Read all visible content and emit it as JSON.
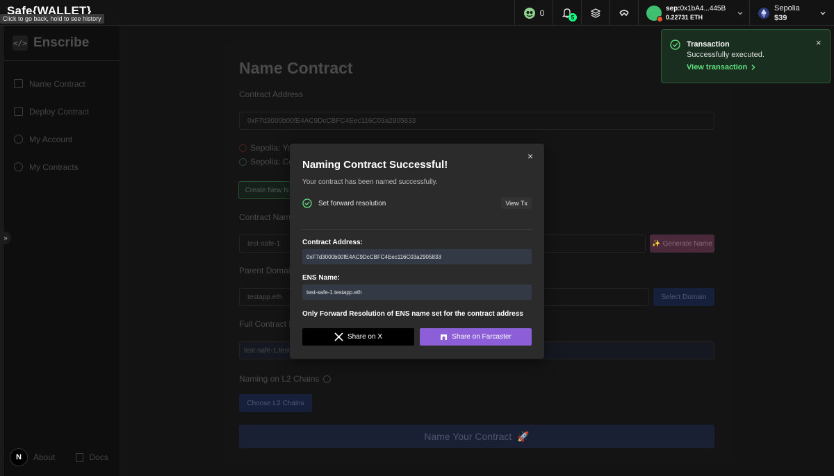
{
  "safe_bar": {
    "brand": "Safe{WALLET}",
    "tooltip": "Click to go back, hold to see history",
    "points": "0",
    "notifications_count": "5",
    "account": {
      "prefix": "sep:",
      "address": "0x1bA4...445B",
      "balance": "0.22731 ETH"
    },
    "network": {
      "name": "Sepolia",
      "value": "$39"
    }
  },
  "sidebar": {
    "logo": "Enscribe",
    "logo_glyph": "</>",
    "items": [
      {
        "label": "Name Contract",
        "icon": "file-icon"
      },
      {
        "label": "Deploy Contract",
        "icon": "edit-icon"
      },
      {
        "label": "My Account",
        "icon": "user-icon"
      },
      {
        "label": "My Contracts",
        "icon": "clock-icon"
      }
    ],
    "footer": {
      "badge": "N",
      "about": "About",
      "docs": "Docs"
    },
    "expand_glyph": "»"
  },
  "form": {
    "title": "Name Contract",
    "contract_address_label": "Contract Address",
    "contract_address_value": "0xF7d3000b00fE4AC9DcCBFC4Eec116C03a2905833",
    "status_1": "Sepolia: Yo",
    "status_2": "Sepolia: Co",
    "create_new_label": "Create New N",
    "contract_name_label": "Contract Name",
    "contract_name_value": "test-safe-1",
    "generate_name_label": "Generate Name",
    "parent_domain_label": "Parent Domain",
    "parent_domain_value": "testapp.eth",
    "select_domain_label": "Select Domain",
    "full_name_label": "Full Contract N",
    "full_name_value": "test-safe-1.testa",
    "l2_label": "Naming on L2 Chains",
    "choose_l2_label": "Choose L2 Chains",
    "submit_label": "Name Your Contract"
  },
  "toast": {
    "title": "Transaction",
    "message": "Successfully executed.",
    "link": "View transaction",
    "close": "×"
  },
  "modal": {
    "title": "Naming Contract Successful!",
    "subtitle": "Your contract has been named successfully.",
    "step_label": "Set forward resolution",
    "view_tx": "View Tx",
    "contract_address_label": "Contract Address:",
    "contract_address_value": "0xF7d3000b00fE4AC9DcCBFC4Eec116C03a2905833",
    "ens_name_label": "ENS Name:",
    "ens_name_value": "test-safe-1.testapp.eth",
    "note": "Only Forward Resolution of ENS name set for the contract address",
    "share_x": "Share on X",
    "share_farcaster": "Share on Farcaster",
    "close": "×"
  },
  "colors": {
    "success_green": "#5fe07f",
    "farcaster_purple": "#8c5fd8",
    "safe_green": "#12ff80"
  }
}
